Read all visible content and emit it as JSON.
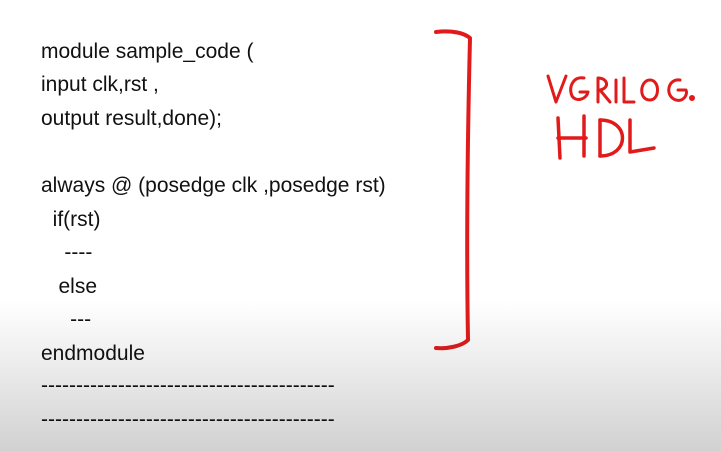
{
  "code": {
    "lines": [
      "module sample_code (",
      "input clk,rst ,",
      "output result,done);",
      "always @ (posedge clk ,posedge rst)",
      "  if(rst)",
      "    ----",
      "   else",
      "     ---",
      "endmodule",
      "------------------------------------------",
      "------------------------------------------"
    ]
  },
  "annotation": {
    "handwriting": [
      "VERILOG.",
      "HDL"
    ],
    "ink_color": "#e11b1b"
  }
}
